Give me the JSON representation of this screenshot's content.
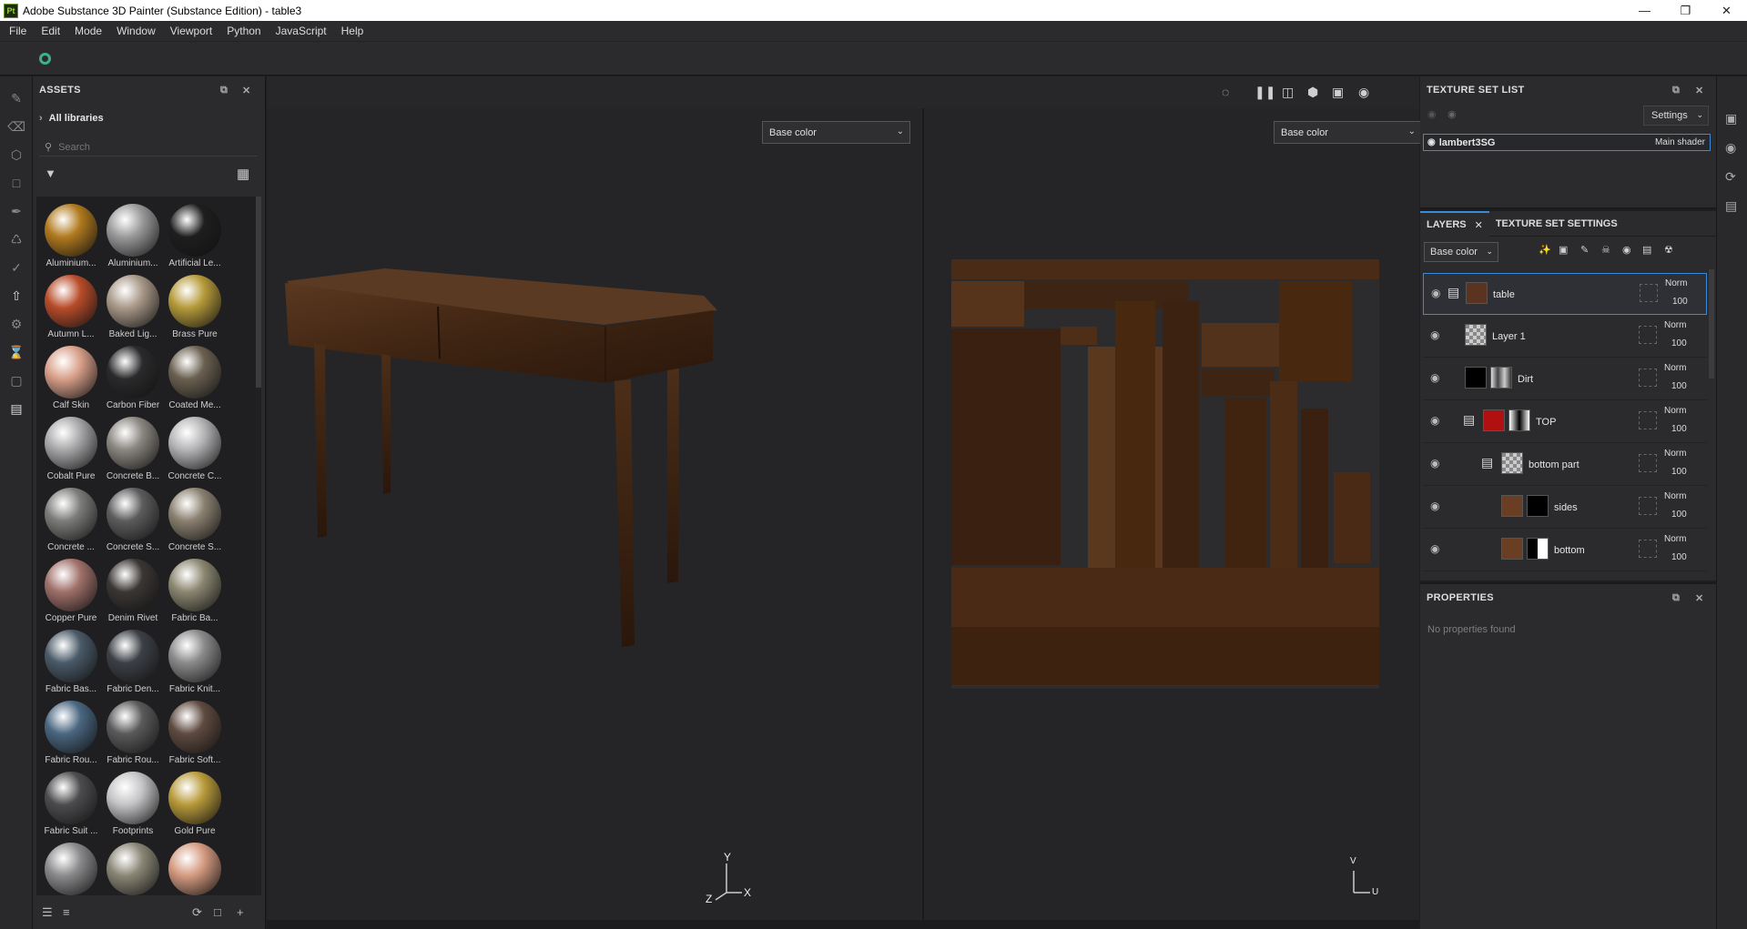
{
  "window": {
    "title": "Adobe Substance 3D Painter (Substance Edition) - table3",
    "logo": "Pt"
  },
  "menu": [
    "File",
    "Edit",
    "Mode",
    "Window",
    "Viewport",
    "Python",
    "JavaScript",
    "Help"
  ],
  "assets": {
    "title": "ASSETS",
    "library": "All libraries",
    "search_placeholder": "Search",
    "items": [
      {
        "label": "Aluminium...",
        "color": "#b07a1e"
      },
      {
        "label": "Aluminium...",
        "color": "#9a9a9a"
      },
      {
        "label": "Artificial Le...",
        "color": "#1e1e1e"
      },
      {
        "label": "Autumn L...",
        "color": "#b84c2a"
      },
      {
        "label": "Baked Lig...",
        "color": "#a89888"
      },
      {
        "label": "Brass Pure",
        "color": "#b59a3a"
      },
      {
        "label": "Calf Skin",
        "color": "#d9a08a"
      },
      {
        "label": "Carbon Fiber",
        "color": "#2a2a2c"
      },
      {
        "label": "Coated Me...",
        "color": "#6a6050"
      },
      {
        "label": "Cobalt Pure",
        "color": "#a8a8aa"
      },
      {
        "label": "Concrete B...",
        "color": "#8a8680"
      },
      {
        "label": "Concrete C...",
        "color": "#b4b4b6"
      },
      {
        "label": "Concrete ...",
        "color": "#7c7c7a"
      },
      {
        "label": "Concrete S...",
        "color": "#5c5c5c"
      },
      {
        "label": "Concrete S...",
        "color": "#8a8070"
      },
      {
        "label": "Copper Pure",
        "color": "#a0706a"
      },
      {
        "label": "Denim Rivet",
        "color": "#3a3634"
      },
      {
        "label": "Fabric Ba...",
        "color": "#8a8670"
      },
      {
        "label": "Fabric Bas...",
        "color": "#4a5a68"
      },
      {
        "label": "Fabric Den...",
        "color": "#3c4046"
      },
      {
        "label": "Fabric Knit...",
        "color": "#8a8a8a"
      },
      {
        "label": "Fabric Rou...",
        "color": "#4a6680"
      },
      {
        "label": "Fabric Rou...",
        "color": "#5a5a5a"
      },
      {
        "label": "Fabric Soft...",
        "color": "#5e4a40"
      },
      {
        "label": "Fabric Suit ...",
        "color": "#4c4c4e"
      },
      {
        "label": "Footprints",
        "color": "#c4c4c6"
      },
      {
        "label": "Gold Pure",
        "color": "#b89a3a"
      },
      {
        "label": "",
        "color": "#8a8a8c"
      },
      {
        "label": "",
        "color": "#8a8676"
      },
      {
        "label": "",
        "color": "#d49a80"
      }
    ]
  },
  "viewport": {
    "left_channel": "Base color",
    "right_channel": "Base color",
    "axes_3d": {
      "y": "Y",
      "z": "Z",
      "x": "X"
    },
    "axes_uv": {
      "v": "V",
      "u": "U"
    }
  },
  "texture_set_list": {
    "title": "TEXTURE SET LIST",
    "settings": "Settings",
    "set_name": "lambert3SG",
    "shader": "Main shader"
  },
  "layers": {
    "tab_layers": "LAYERS",
    "tab_tss": "TEXTURE SET SETTINGS",
    "channel": "Base color",
    "rows": [
      {
        "name": "table",
        "blend": "Norm",
        "opacity": "100"
      },
      {
        "name": "Layer 1",
        "blend": "Norm",
        "opacity": "100"
      },
      {
        "name": "Dirt",
        "blend": "Norm",
        "opacity": "100"
      },
      {
        "name": "TOP",
        "blend": "Norm",
        "opacity": "100"
      },
      {
        "name": "bottom part",
        "blend": "Norm",
        "opacity": "100"
      },
      {
        "name": "sides",
        "blend": "Norm",
        "opacity": "100"
      },
      {
        "name": "bottom",
        "blend": "Norm",
        "opacity": "100"
      }
    ]
  },
  "properties": {
    "title": "PROPERTIES",
    "empty": "No properties found"
  },
  "colors": {
    "accent": "#3a8ad8",
    "sync": "#3fb08f",
    "wood": "#4a2c18"
  }
}
